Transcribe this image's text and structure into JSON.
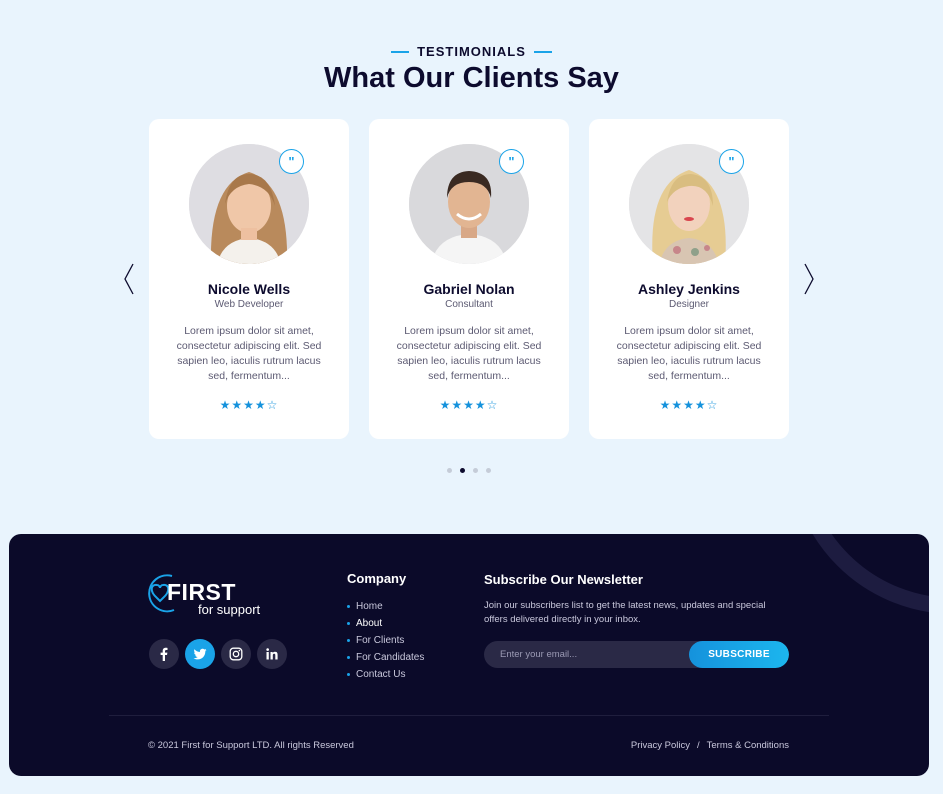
{
  "testimonials": {
    "eyebrow": "TESTIMONIALS",
    "headline": "What Our Clients Say",
    "cards": [
      {
        "name": "Nicole Wells",
        "role": "Web Developer",
        "quote": "Lorem ipsum dolor sit amet, consectetur adipiscing elit. Sed sapien leo, iaculis rutrum lacus sed, fermentum...",
        "stars": "★★★★☆",
        "rating": 4,
        "quote_icon": "quote-icon"
      },
      {
        "name": "Gabriel Nolan",
        "role": "Consultant",
        "quote": "Lorem ipsum dolor sit amet, consectetur adipiscing elit. Sed sapien leo, iaculis rutrum lacus sed, fermentum...",
        "stars": "★★★★☆",
        "rating": 4,
        "quote_icon": "quote-icon"
      },
      {
        "name": "Ashley Jenkins",
        "role": "Designer",
        "quote": "Lorem ipsum dolor sit amet, consectetur adipiscing elit. Sed sapien leo, iaculis rutrum lacus sed, fermentum...",
        "stars": "★★★★☆",
        "rating": 4,
        "quote_icon": "quote-icon"
      }
    ],
    "pagination": {
      "count": 4,
      "active_index": 1
    },
    "arrows": [
      "chevron-left-icon",
      "chevron-right-icon"
    ]
  },
  "footer": {
    "logo_text": "FIRST",
    "logo_sub": "for support",
    "socials": [
      "facebook-icon",
      "twitter-icon",
      "instagram-icon",
      "linkedin-icon"
    ],
    "company_title": "Company",
    "company_links": [
      "Home",
      "About",
      "For Clients",
      "For Candidates",
      "Contact Us"
    ],
    "newsletter_title": "Subscribe Our Newsletter",
    "newsletter_text": "Join our subscribers list to get the latest news, updates and special offers delivered directly in your inbox.",
    "email_placeholder": "Enter your email...",
    "subscribe_label": "SUBSCRIBE",
    "copyright": "© 2021 First for Support LTD. All rights Reserved",
    "privacy_label": "Privacy Policy",
    "separator": "/",
    "terms_label": "Terms & Conditions"
  },
  "colors": {
    "background": "#e9f4fd",
    "navy": "#0d0b2e",
    "footer_bg": "#0b0a29",
    "accent": "#1aa3e8"
  }
}
